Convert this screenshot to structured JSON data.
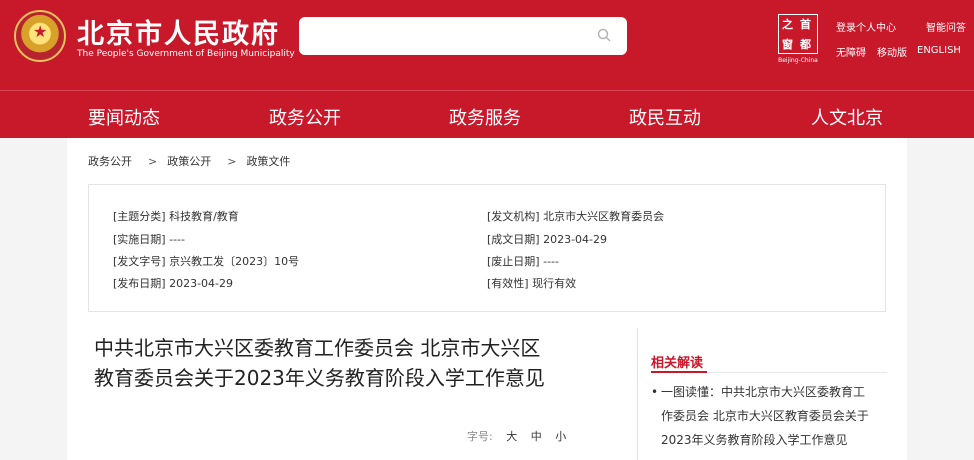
{
  "header": {
    "site_title": "北京市人民政府",
    "site_subtitle": "The People's Government of Beijing Municipality",
    "search_placeholder": "",
    "logo": {
      "char_1": "之",
      "char_2": "首",
      "char_3": "窗",
      "char_4": "都",
      "caption": "Beijing-China"
    },
    "links": {
      "login": "登录个人中心",
      "assistant": "智能问答",
      "accessibility": "无障碍",
      "mobile": "移动版",
      "english": "ENGLISH"
    },
    "brand_color": "#c8192b"
  },
  "nav": [
    "要闻动态",
    "政务公开",
    "政务服务",
    "政民互动",
    "人文北京"
  ],
  "breadcrumb": [
    "政务公开",
    "政策公开",
    "政策文件"
  ],
  "breadcrumb_sep": ">",
  "meta": {
    "category_k": "[主题分类]",
    "category_v": "科技教育/教育",
    "issuer_k": "[发文机构]",
    "issuer_v": "北京市大兴区教育委员会",
    "impl_date_k": "[实施日期]",
    "impl_date_v": "----",
    "created_k": "[成文日期]",
    "created_v": "2023-04-29",
    "doc_no_k": "[发文字号]",
    "doc_no_v": "京兴教工发〔2023〕10号",
    "abolish_k": "[废止日期]",
    "abolish_v": "----",
    "pub_date_k": "[发布日期]",
    "pub_date_v": "2023-04-29",
    "validity_k": "[有效性]",
    "validity_v": "现行有效"
  },
  "document": {
    "title_line1": "中共北京市大兴区委教育工作委员会 北京市大兴区",
    "title_line2": "教育委员会关于2023年义务教育阶段入学工作意见",
    "font_label": "字号:",
    "font_large": "大",
    "font_medium": "中",
    "font_small": "小"
  },
  "related": {
    "title": "相关解读",
    "item_bullet": "•",
    "item_line1": "一图读懂：中共北京市大兴区委教育工",
    "item_line2": "作委员会 北京市大兴区教育委员会关于",
    "item_line3": "2023年义务教育阶段入学工作意见"
  }
}
